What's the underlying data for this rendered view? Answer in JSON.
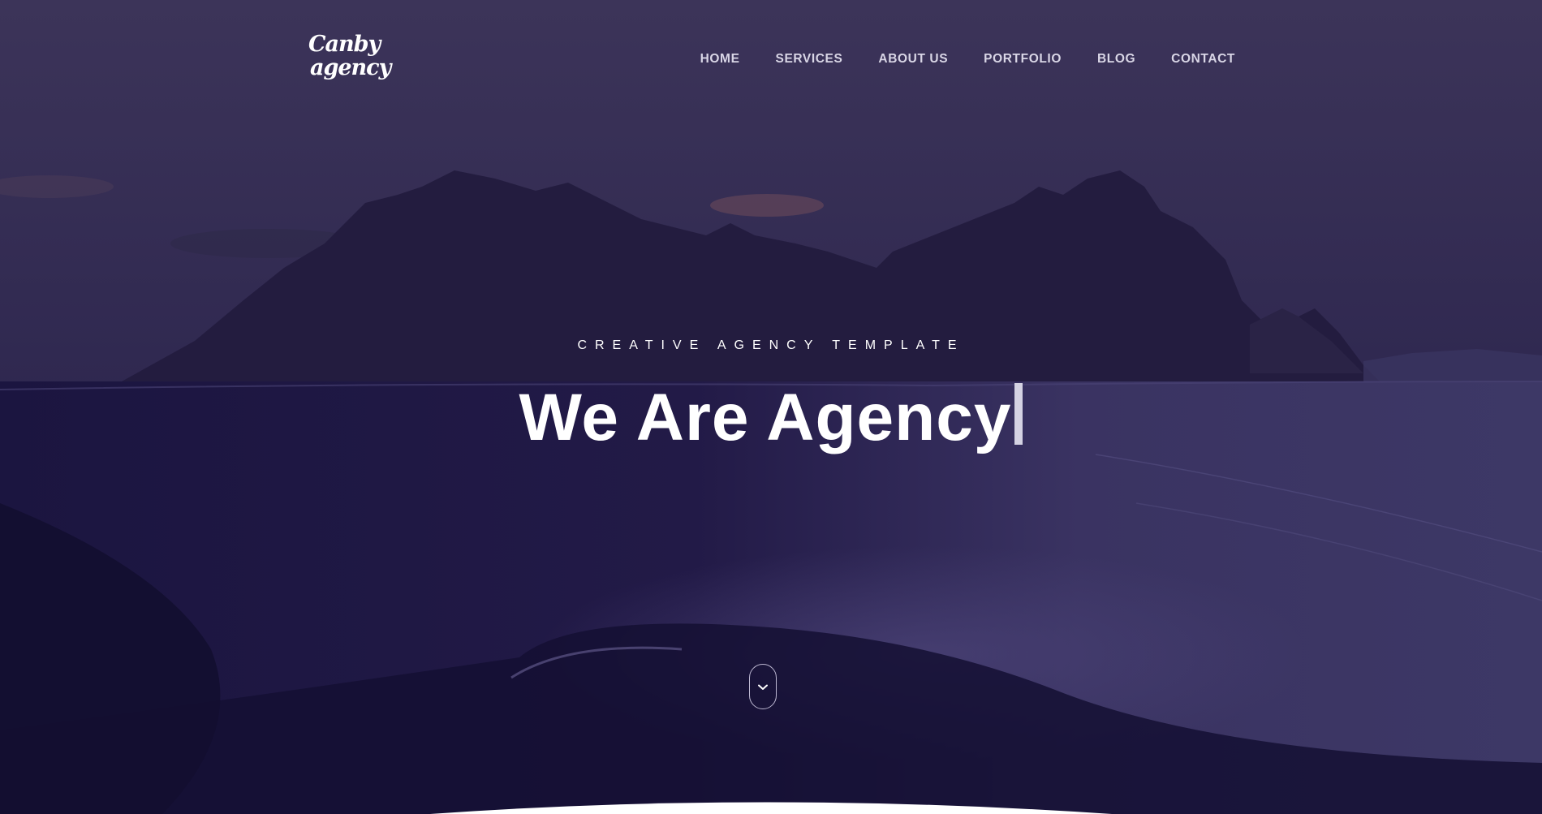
{
  "brand": {
    "logo_line1": "Canby",
    "logo_line2": "agency"
  },
  "nav": {
    "items": [
      {
        "label": "HOME"
      },
      {
        "label": "SERVICES"
      },
      {
        "label": "ABOUT US"
      },
      {
        "label": "PORTFOLIO"
      },
      {
        "label": "BLOG"
      },
      {
        "label": "CONTACT"
      }
    ]
  },
  "hero": {
    "kicker": "CREATIVE AGENCY TEMPLATE",
    "headline": "We Are Agency",
    "scroll_icon": "chevron-down-icon"
  },
  "colors": {
    "overlay": "#2a2248",
    "text": "#ffffff",
    "nav_text": "#d9d6e6"
  }
}
